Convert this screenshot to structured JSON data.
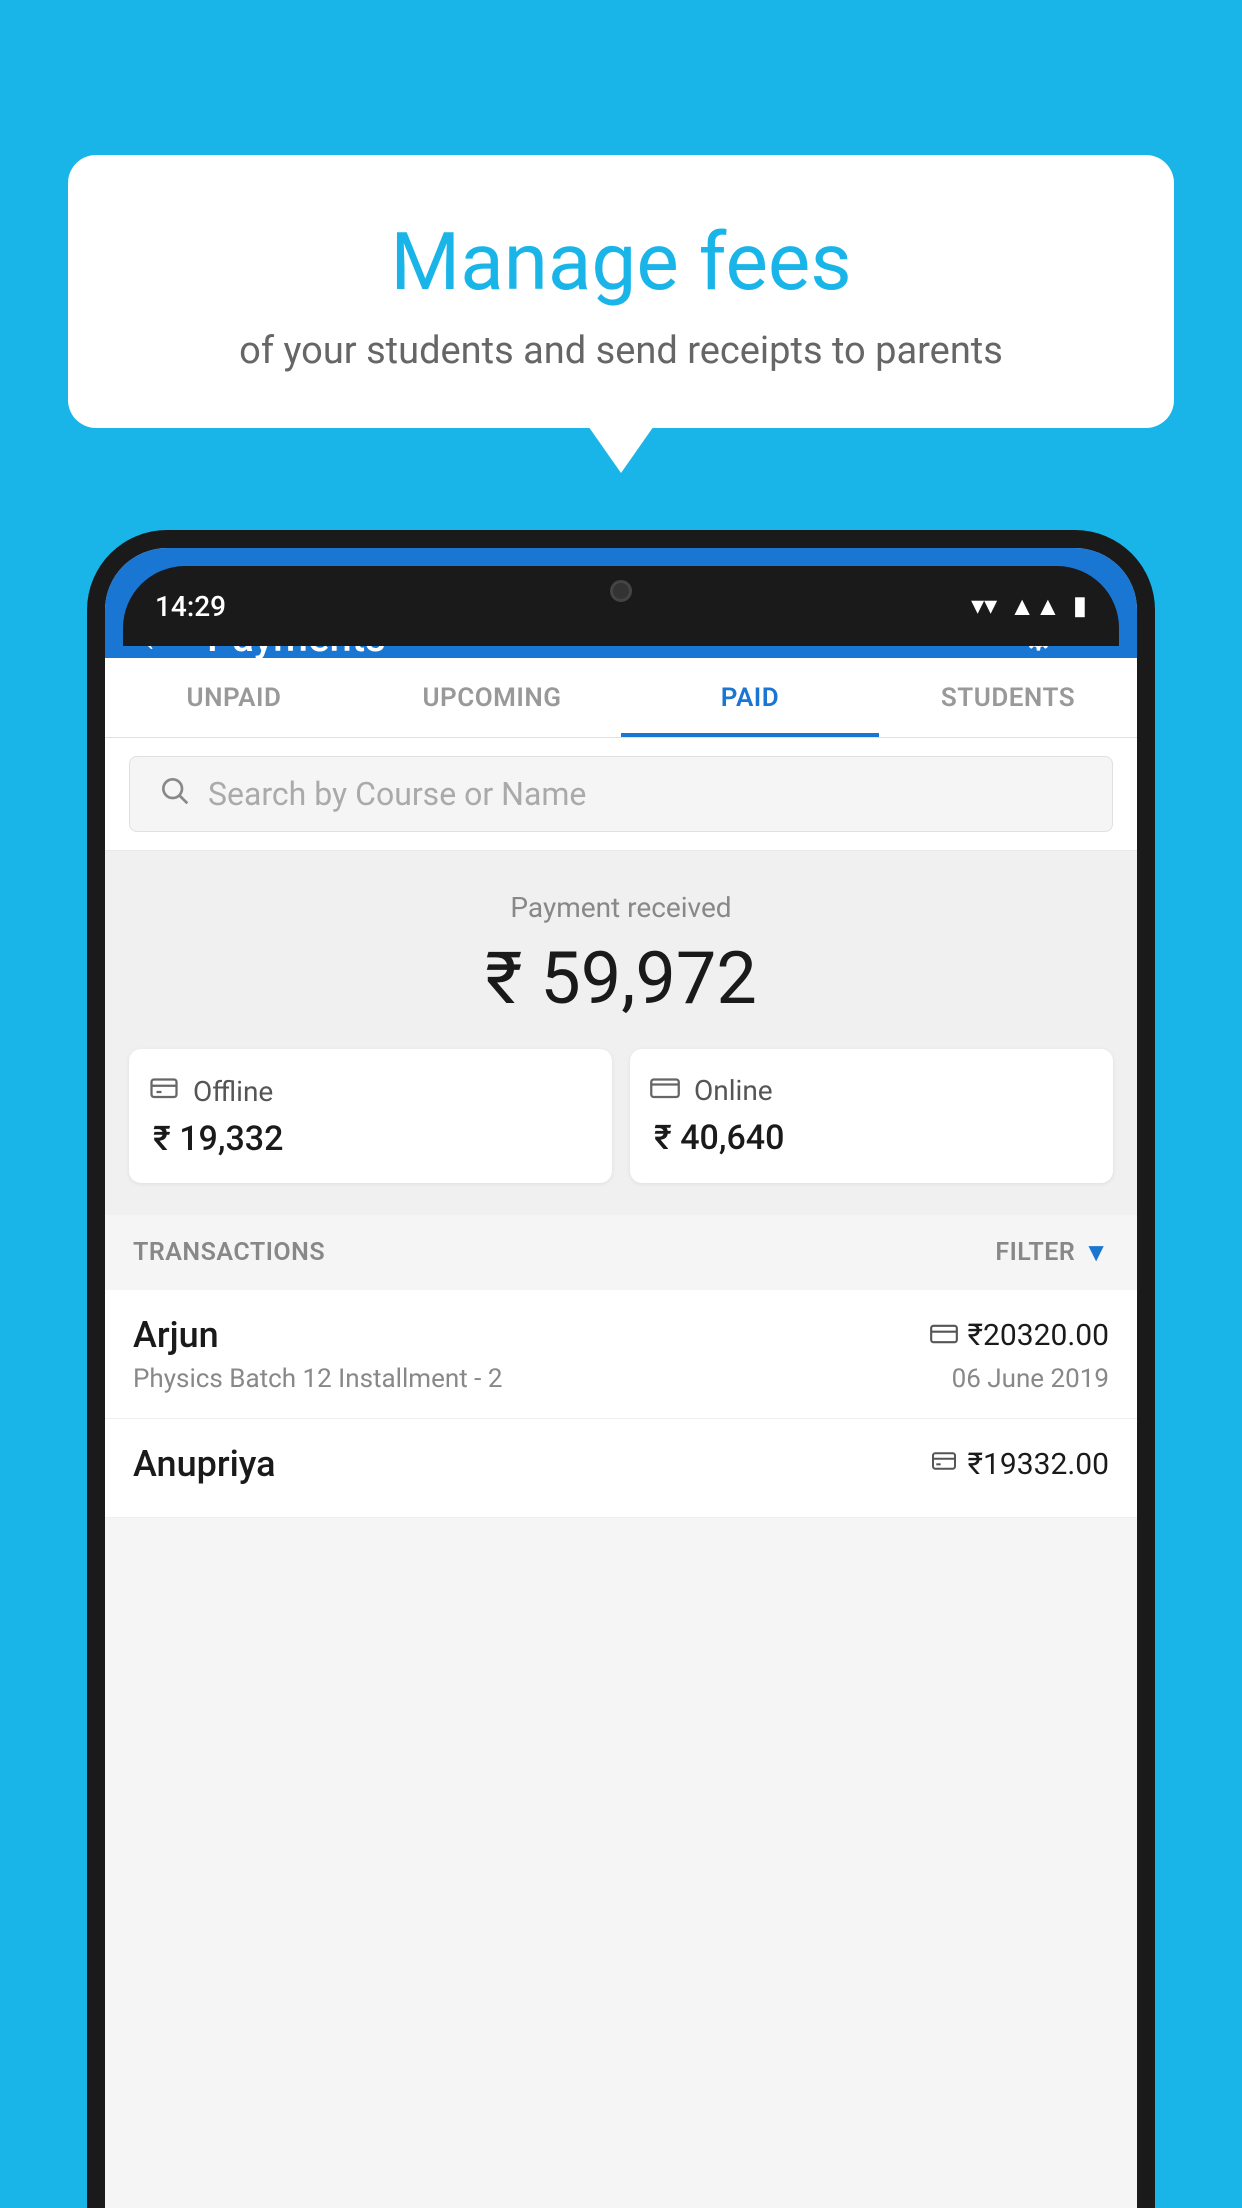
{
  "background_color": "#1ab5e8",
  "bubble": {
    "title": "Manage fees",
    "subtitle": "of your students and send receipts to parents"
  },
  "status_bar": {
    "time": "14:29",
    "icons": [
      "wifi",
      "signal",
      "battery"
    ]
  },
  "app_bar": {
    "title": "Payments",
    "back_label": "←",
    "gear_label": "⚙",
    "plus_label": "+"
  },
  "tabs": [
    {
      "label": "UNPAID",
      "active": false
    },
    {
      "label": "UPCOMING",
      "active": false
    },
    {
      "label": "PAID",
      "active": true
    },
    {
      "label": "STUDENTS",
      "active": false
    }
  ],
  "search": {
    "placeholder": "Search by Course or Name"
  },
  "payment_summary": {
    "label": "Payment received",
    "amount": "₹ 59,972",
    "offline": {
      "type": "Offline",
      "amount": "₹ 19,332"
    },
    "online": {
      "type": "Online",
      "amount": "₹ 40,640"
    }
  },
  "transactions_header": {
    "label": "TRANSACTIONS",
    "filter_label": "FILTER"
  },
  "transactions": [
    {
      "name": "Arjun",
      "course": "Physics Batch 12 Installment - 2",
      "amount": "₹20320.00",
      "date": "06 June 2019",
      "payment_type": "online"
    },
    {
      "name": "Anupriya",
      "course": "",
      "amount": "₹19332.00",
      "date": "",
      "payment_type": "offline"
    }
  ]
}
